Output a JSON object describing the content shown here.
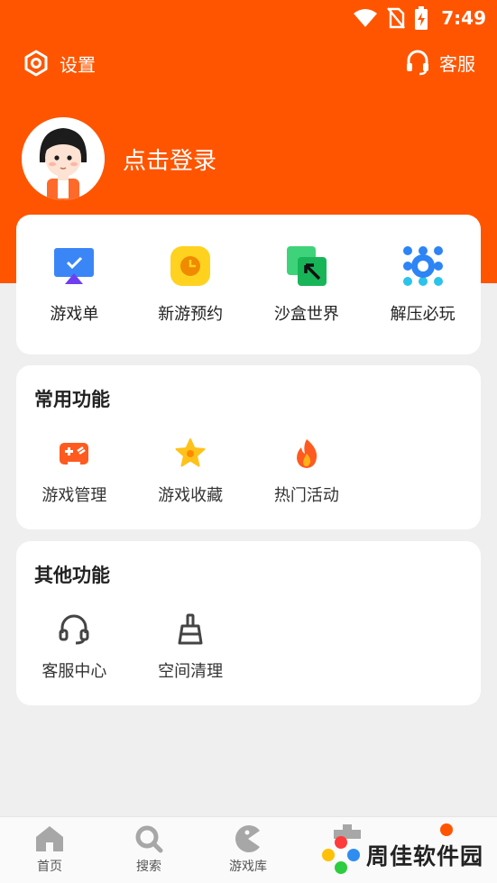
{
  "status_bar": {
    "time": "7:49",
    "icons": [
      "wifi-icon",
      "no-sim-icon",
      "battery-charging-icon"
    ]
  },
  "header": {
    "settings_label": "设置",
    "service_label": "客服",
    "login_label": "点击登录",
    "color": "#ff5500"
  },
  "quick_grid": {
    "items": [
      {
        "label": "游戏单",
        "icon": "game-list-icon"
      },
      {
        "label": "新游预约",
        "icon": "clock-icon"
      },
      {
        "label": "沙盒世界",
        "icon": "sandbox-icon"
      },
      {
        "label": "解压必玩",
        "icon": "gear-dots-icon"
      }
    ]
  },
  "common": {
    "title": "常用功能",
    "items": [
      {
        "label": "游戏管理",
        "icon": "gamepad-icon"
      },
      {
        "label": "游戏收藏",
        "icon": "star-icon"
      },
      {
        "label": "热门活动",
        "icon": "fire-icon"
      }
    ]
  },
  "other": {
    "title": "其他功能",
    "items": [
      {
        "label": "客服中心",
        "icon": "headset-icon"
      },
      {
        "label": "空间清理",
        "icon": "broom-icon"
      }
    ]
  },
  "tabbar": {
    "items": [
      {
        "label": "首页",
        "icon": "home-icon"
      },
      {
        "label": "搜索",
        "icon": "search-icon"
      },
      {
        "label": "游戏库",
        "icon": "pacman-icon"
      }
    ]
  },
  "watermark": {
    "text": "周佳软件园"
  }
}
